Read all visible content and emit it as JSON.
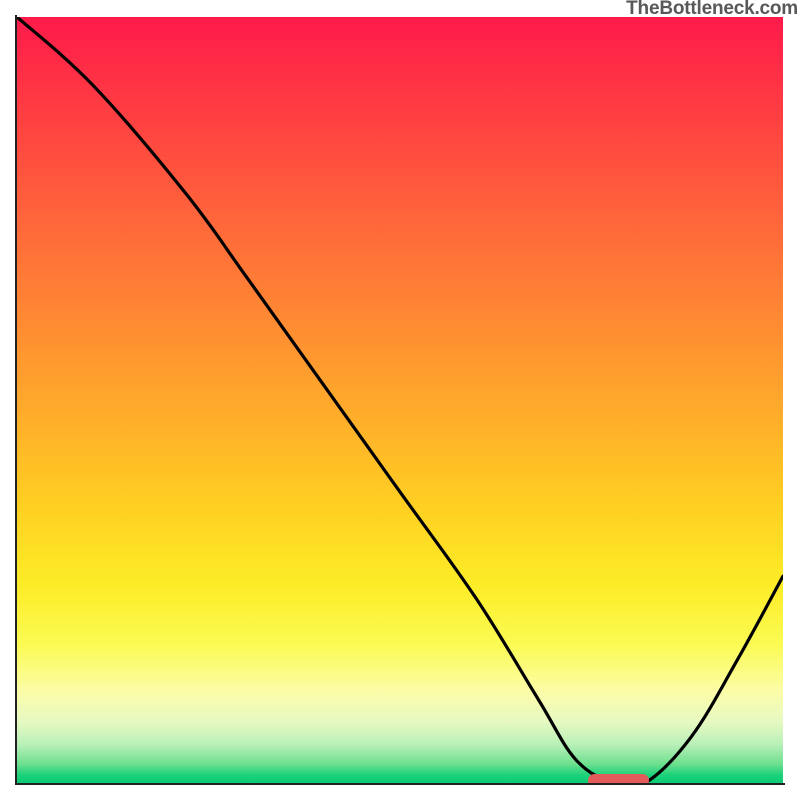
{
  "watermark": "TheBottleneck.com",
  "chart_data": {
    "type": "line",
    "title": "",
    "xlabel": "",
    "ylabel": "",
    "xlim": [
      0,
      100
    ],
    "ylim": [
      0,
      100
    ],
    "grid": false,
    "legend": false,
    "series": [
      {
        "name": "bottleneck-curve",
        "x": [
          0,
          10,
          22,
          30,
          40,
          50,
          60,
          68,
          73,
          78,
          82,
          88,
          94,
          100
        ],
        "y": [
          100,
          91,
          77,
          66,
          52,
          38,
          24,
          11,
          3,
          0,
          0,
          6,
          16,
          27
        ]
      }
    ],
    "marker": {
      "name": "optimal-range",
      "x_start": 74.5,
      "x_end": 82.5,
      "y": 0.3
    },
    "background_gradient": {
      "top": "#ff1a4a",
      "upper_mid": "#ffad2a",
      "lower_mid": "#fcec26",
      "bottom": "#0acb75"
    }
  }
}
